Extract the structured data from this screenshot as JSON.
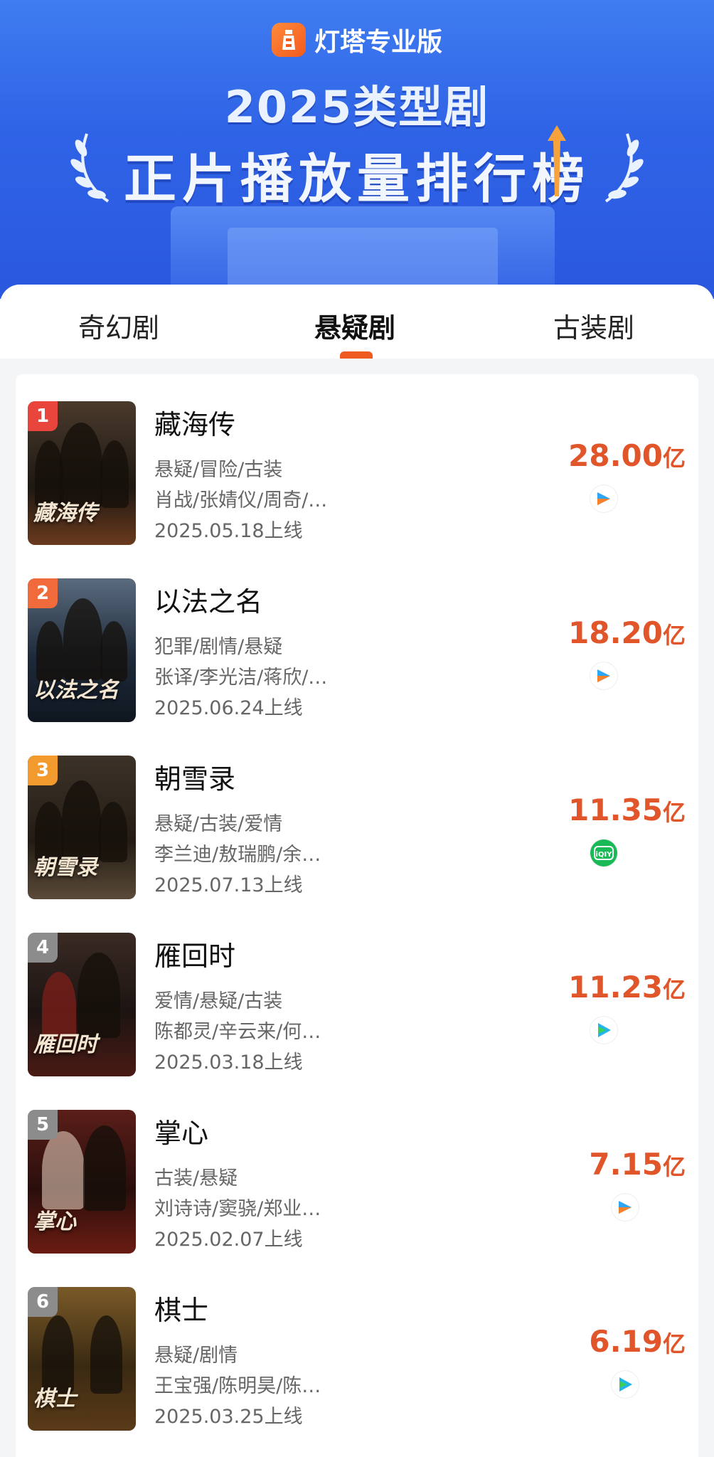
{
  "header": {
    "brand": "灯塔专业版",
    "title_line1": "2025类型剧",
    "title_line2": "正片播放量排行榜"
  },
  "tabs": [
    "奇幻剧",
    "悬疑剧",
    "古装剧"
  ],
  "active_tab": 1,
  "accent_color": "#e0552a",
  "items": [
    {
      "rank": "1",
      "name": "藏海传",
      "genre": "悬疑/冒险/古装",
      "cast": "肖战/张婧仪/周奇/…",
      "date": "2025.05.18上线",
      "value": "28.00",
      "unit": "亿",
      "platform": "youku-icon",
      "poster_text": "藏海传"
    },
    {
      "rank": "2",
      "name": "以法之名",
      "genre": "犯罪/剧情/悬疑",
      "cast": "张译/李光洁/蒋欣/…",
      "date": "2025.06.24上线",
      "value": "18.20",
      "unit": "亿",
      "platform": "youku-icon",
      "poster_text": "以法之名"
    },
    {
      "rank": "3",
      "name": "朝雪录",
      "genre": "悬疑/古装/爱情",
      "cast": "李兰迪/敖瑞鹏/余…",
      "date": "2025.07.13上线",
      "value": "11.35",
      "unit": "亿",
      "platform": "iqiyi-icon",
      "poster_text": "朝雪录"
    },
    {
      "rank": "4",
      "name": "雁回时",
      "genre": "爱情/悬疑/古装",
      "cast": "陈都灵/辛云来/何…",
      "date": "2025.03.18上线",
      "value": "11.23",
      "unit": "亿",
      "platform": "tencent-video-icon",
      "poster_text": "雁回时"
    },
    {
      "rank": "5",
      "name": "掌心",
      "genre": "古装/悬疑",
      "cast": "刘诗诗/窦骁/郑业…",
      "date": "2025.02.07上线",
      "value": "7.15",
      "unit": "亿",
      "platform": "youku-icon",
      "poster_text": "掌心"
    },
    {
      "rank": "6",
      "name": "棋士",
      "genre": "悬疑/剧情",
      "cast": "王宝强/陈明昊/陈…",
      "date": "2025.03.25上线",
      "value": "6.19",
      "unit": "亿",
      "platform": "tencent-video-icon",
      "poster_text": "棋士"
    }
  ]
}
